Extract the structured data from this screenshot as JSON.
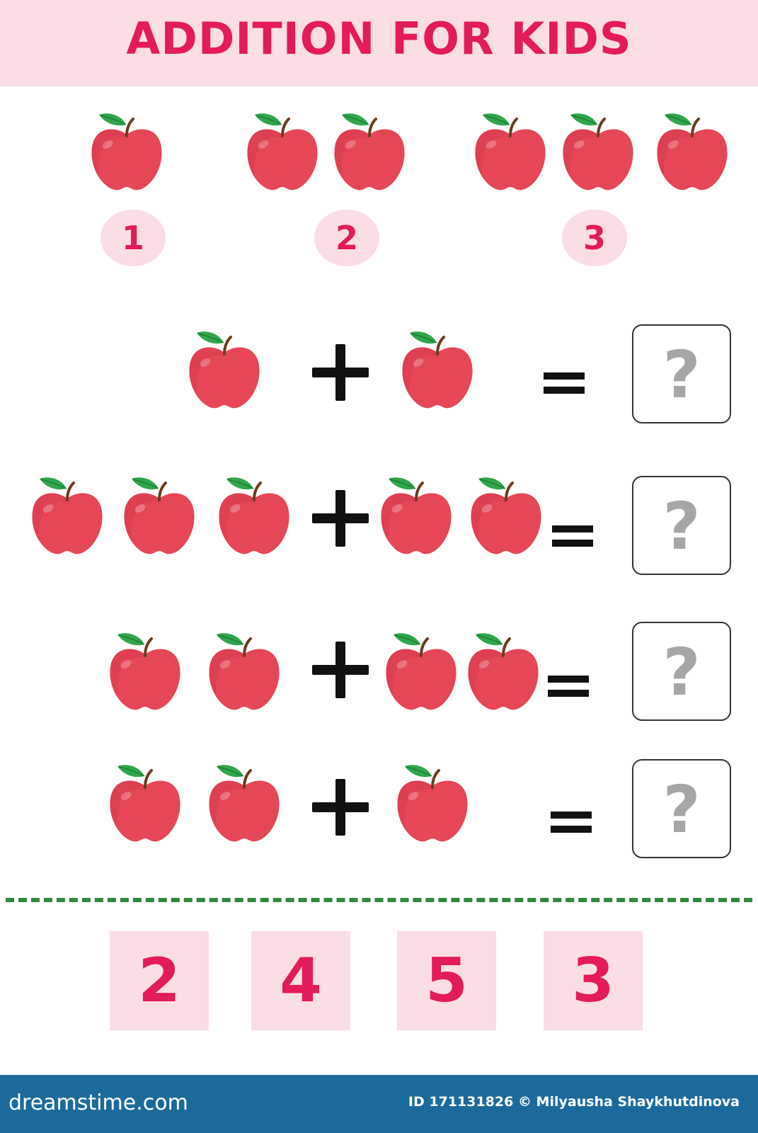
{
  "header": {
    "title": "ADDITION FOR KIDS"
  },
  "colors": {
    "accent_pink": "#e31b5a",
    "light_pink": "#fbdde5",
    "apple_red": "#e54757",
    "leaf_green": "#2fa64a",
    "divider_green": "#2f8a3e",
    "footer_blue": "#1c6a9c"
  },
  "counting_examples": [
    {
      "apples": 1,
      "label": "1"
    },
    {
      "apples": 2,
      "label": "2"
    },
    {
      "apples": 3,
      "label": "3"
    }
  ],
  "equations": [
    {
      "left_apples": 1,
      "right_apples": 1,
      "plus_sign": "+",
      "equals_sign": "=",
      "answer_placeholder": "?"
    },
    {
      "left_apples": 3,
      "right_apples": 2,
      "plus_sign": "+",
      "equals_sign": "=",
      "answer_placeholder": "?"
    },
    {
      "left_apples": 2,
      "right_apples": 2,
      "plus_sign": "+",
      "equals_sign": "=",
      "answer_placeholder": "?"
    },
    {
      "left_apples": 2,
      "right_apples": 1,
      "plus_sign": "+",
      "equals_sign": "=",
      "answer_placeholder": "?"
    }
  ],
  "answer_options": [
    "2",
    "4",
    "5",
    "3"
  ],
  "footer": {
    "brand": "dreamstime.com",
    "credit": "ID 171131826 © Milyausha Shaykhutdinova"
  },
  "icons": [
    "apple-icon",
    "plus-icon",
    "equals-icon",
    "question-mark-icon"
  ]
}
